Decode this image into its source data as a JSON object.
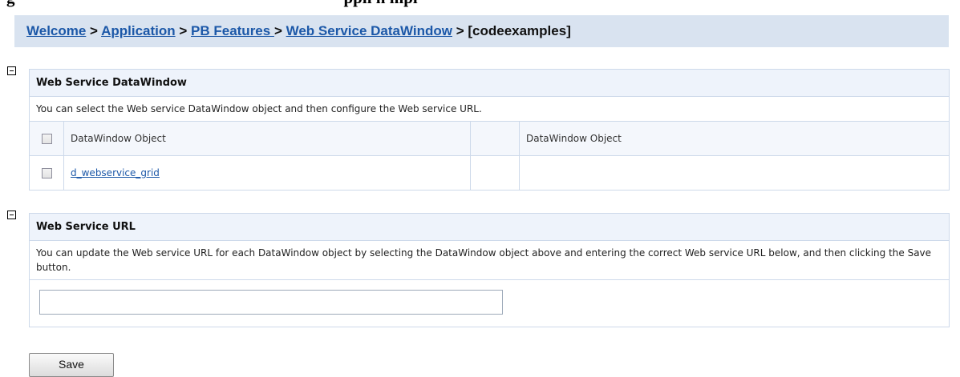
{
  "caption": {
    "left_text": "g",
    "right_text": "ppli n mpl"
  },
  "breadcrumb": {
    "items": [
      "Welcome",
      "Application",
      "PB Features ",
      "Web Service DataWindow"
    ],
    "separator": " > ",
    "current": "[codeexamples]"
  },
  "dw_panel": {
    "title": "Web Service DataWindow",
    "description": "You can select the Web service DataWindow object and then configure the Web service URL.",
    "columns": [
      "DataWindow Object",
      "",
      "DataWindow Object"
    ],
    "rows": [
      {
        "name": "d_webservice_grid",
        "checked": false
      }
    ]
  },
  "url_panel": {
    "title": "Web Service URL",
    "description": "You can update the Web service URL for each DataWindow object by selecting the DataWindow object above and entering the correct Web service URL below, and then clicking the Save button.",
    "url_value": ""
  },
  "save_label": "Save",
  "colors": {
    "breadcrumb_bg": "#d9e3f0",
    "link": "#1c58a8",
    "panel_header_bg": "#eef3fb",
    "border": "#cdd9ea"
  },
  "icons": {
    "collapse": "minus-square-icon"
  }
}
